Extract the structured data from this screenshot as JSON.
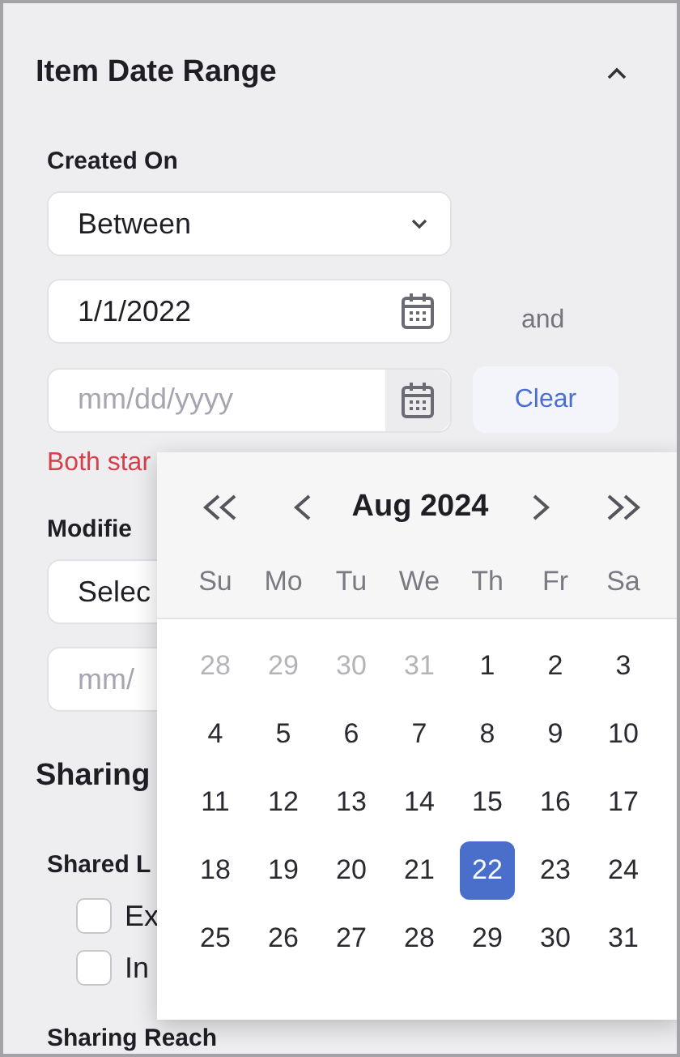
{
  "section": {
    "title": "Item Date Range",
    "expanded": true
  },
  "created_on": {
    "label": "Created On",
    "operator": "Between",
    "start": {
      "value": "1/1/2022"
    },
    "joiner": "and",
    "end": {
      "placeholder": "mm/dd/yyyy"
    },
    "clear_button": "Clear",
    "error": "Both star"
  },
  "modified_on": {
    "label": "Modifie",
    "operator": "Selec",
    "start": {
      "placeholder": "mm/"
    }
  },
  "sharing": {
    "title": "Sharing",
    "shared_label": "Shared L",
    "options": [
      {
        "label": "Ex",
        "checked": false
      },
      {
        "label": "In",
        "checked": false
      }
    ],
    "reach_label": "Sharing Reach"
  },
  "calendar": {
    "month": "Aug 2024",
    "weekdays": [
      "Su",
      "Mo",
      "Tu",
      "We",
      "Th",
      "Fr",
      "Sa"
    ],
    "days": [
      {
        "label": "28",
        "outside": true,
        "selected": false
      },
      {
        "label": "29",
        "outside": true,
        "selected": false
      },
      {
        "label": "30",
        "outside": true,
        "selected": false
      },
      {
        "label": "31",
        "outside": true,
        "selected": false
      },
      {
        "label": "1",
        "outside": false,
        "selected": false
      },
      {
        "label": "2",
        "outside": false,
        "selected": false
      },
      {
        "label": "3",
        "outside": false,
        "selected": false
      },
      {
        "label": "4",
        "outside": false,
        "selected": false
      },
      {
        "label": "5",
        "outside": false,
        "selected": false
      },
      {
        "label": "6",
        "outside": false,
        "selected": false
      },
      {
        "label": "7",
        "outside": false,
        "selected": false
      },
      {
        "label": "8",
        "outside": false,
        "selected": false
      },
      {
        "label": "9",
        "outside": false,
        "selected": false
      },
      {
        "label": "10",
        "outside": false,
        "selected": false
      },
      {
        "label": "11",
        "outside": false,
        "selected": false
      },
      {
        "label": "12",
        "outside": false,
        "selected": false
      },
      {
        "label": "13",
        "outside": false,
        "selected": false
      },
      {
        "label": "14",
        "outside": false,
        "selected": false
      },
      {
        "label": "15",
        "outside": false,
        "selected": false
      },
      {
        "label": "16",
        "outside": false,
        "selected": false
      },
      {
        "label": "17",
        "outside": false,
        "selected": false
      },
      {
        "label": "18",
        "outside": false,
        "selected": false
      },
      {
        "label": "19",
        "outside": false,
        "selected": false
      },
      {
        "label": "20",
        "outside": false,
        "selected": false
      },
      {
        "label": "21",
        "outside": false,
        "selected": false
      },
      {
        "label": "22",
        "outside": false,
        "selected": true
      },
      {
        "label": "23",
        "outside": false,
        "selected": false
      },
      {
        "label": "24",
        "outside": false,
        "selected": false
      },
      {
        "label": "25",
        "outside": false,
        "selected": false
      },
      {
        "label": "26",
        "outside": false,
        "selected": false
      },
      {
        "label": "27",
        "outside": false,
        "selected": false
      },
      {
        "label": "28",
        "outside": false,
        "selected": false
      },
      {
        "label": "29",
        "outside": false,
        "selected": false
      },
      {
        "label": "30",
        "outside": false,
        "selected": false
      },
      {
        "label": "31",
        "outside": false,
        "selected": false
      }
    ]
  }
}
